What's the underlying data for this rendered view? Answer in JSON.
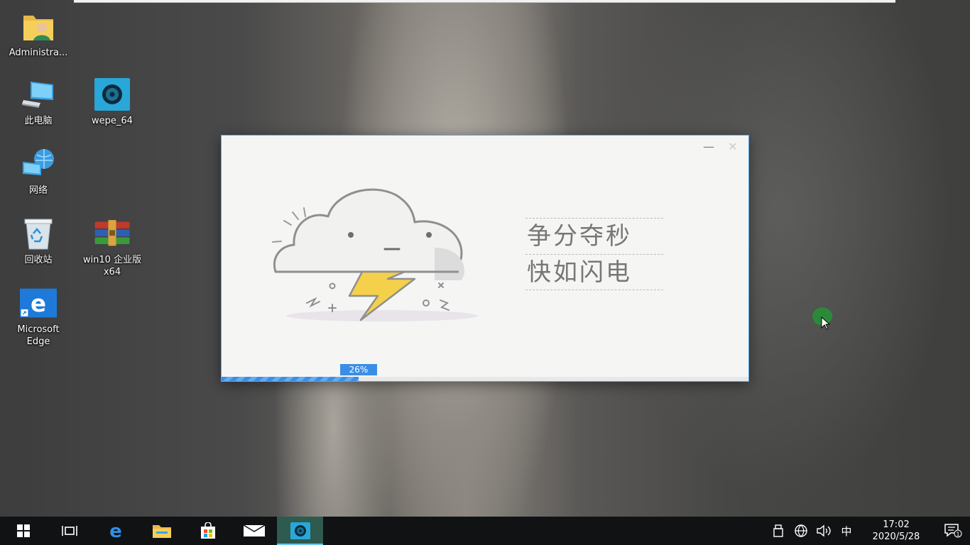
{
  "desktop": {
    "icons": [
      {
        "name": "admin-user-folder",
        "label": "Administra..."
      },
      {
        "name": "this-pc",
        "label": "此电脑"
      },
      {
        "name": "wepe",
        "label": "wepe_64"
      },
      {
        "name": "network",
        "label": "网络"
      },
      {
        "name": "recycle-bin",
        "label": "回收站"
      },
      {
        "name": "win10-archive",
        "label": "win10 企业版\nx64"
      },
      {
        "name": "edge",
        "label": "Microsoft\nEdge"
      }
    ]
  },
  "installer": {
    "minimize_glyph": "—",
    "close_glyph": "✕",
    "slogan_line1": "争分夺秒",
    "slogan_line2": "快如闪电",
    "progress_percent": 26,
    "progress_label": "26%"
  },
  "taskbar": {
    "tray": {
      "ime": "中",
      "time": "17:02",
      "date": "2020/5/28",
      "notification_count": "1"
    }
  },
  "colors": {
    "accent": "#3a8ee6",
    "window_border": "#57a4e8",
    "taskbar": "#101214",
    "lightning": "#f5d04b"
  }
}
